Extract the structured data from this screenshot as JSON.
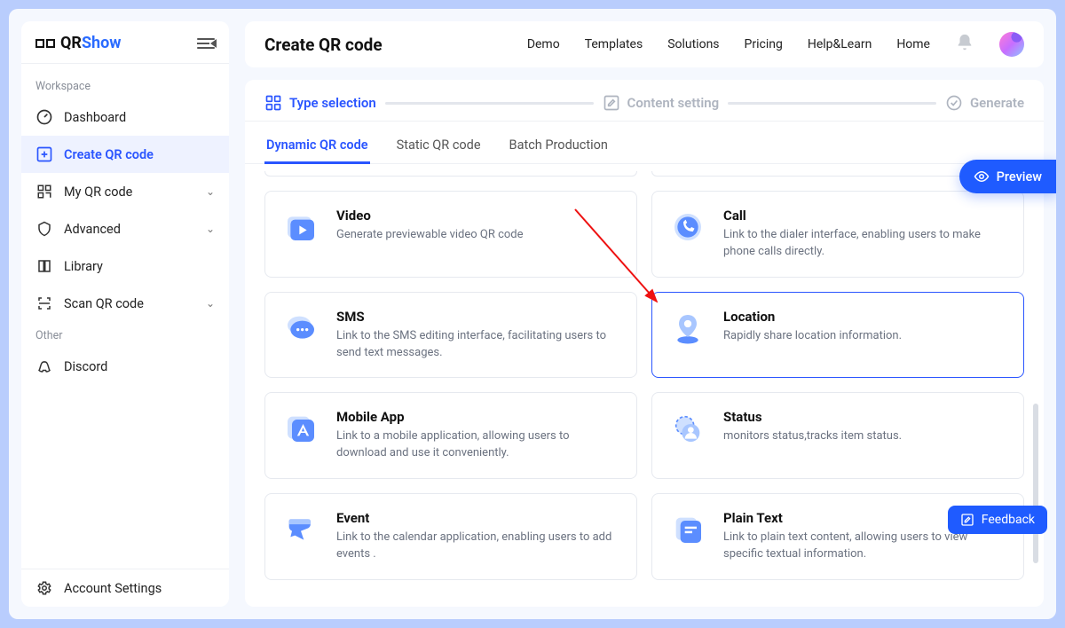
{
  "brand": {
    "part1": "QR",
    "part2": "Show"
  },
  "sidebar": {
    "section1": "Workspace",
    "items": [
      {
        "label": "Dashboard"
      },
      {
        "label": "Create QR code"
      },
      {
        "label": "My QR code"
      },
      {
        "label": "Advanced"
      },
      {
        "label": "Library"
      },
      {
        "label": "Scan QR code"
      }
    ],
    "section2": "Other",
    "other": [
      {
        "label": "Discord"
      }
    ],
    "footer": {
      "label": "Account Settings"
    }
  },
  "header": {
    "title": "Create QR code",
    "nav": [
      "Demo",
      "Templates",
      "Solutions",
      "Pricing",
      "Help&Learn",
      "Home"
    ]
  },
  "steps": {
    "s1": "Type selection",
    "s2": "Content setting",
    "s3": "Generate"
  },
  "subtabs": [
    "Dynamic QR code",
    "Static QR code",
    "Batch Production"
  ],
  "cards": [
    {
      "title": "Video",
      "desc": "Generate previewable video QR code"
    },
    {
      "title": "Call",
      "desc": "Link to the dialer interface, enabling users to make phone calls directly."
    },
    {
      "title": "SMS",
      "desc": "Link to the SMS editing interface, facilitating users to send text messages."
    },
    {
      "title": "Location",
      "desc": "Rapidly share location information."
    },
    {
      "title": "Mobile App",
      "desc": "Link to a mobile application, allowing users to download and use it conveniently."
    },
    {
      "title": "Status",
      "desc": "monitors status,tracks item status."
    },
    {
      "title": "Event",
      "desc": "Link to the calendar application, enabling users to add events ."
    },
    {
      "title": "Plain Text",
      "desc": "Link to plain text content, allowing users to view specific textual information."
    }
  ],
  "preview_label": "Preview",
  "feedback_label": "Feedback"
}
